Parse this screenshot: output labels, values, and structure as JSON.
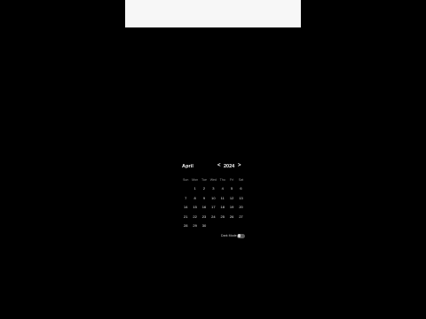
{
  "calendar": {
    "month": "April",
    "year": "2024",
    "prev_label": "<",
    "next_label": ">",
    "weekdays": [
      "Sun",
      "Mon",
      "Tue",
      "Wed",
      "Thu",
      "Fri",
      "Sat"
    ],
    "weeks": [
      [
        "",
        "1",
        "2",
        "3",
        "4",
        "5",
        "6"
      ],
      [
        "7",
        "8",
        "9",
        "10",
        "11",
        "12",
        "13"
      ],
      [
        "14",
        "15",
        "16",
        "17",
        "18",
        "19",
        "20"
      ],
      [
        "21",
        "22",
        "23",
        "24",
        "25",
        "26",
        "27"
      ],
      [
        "28",
        "29",
        "30",
        "",
        "",
        "",
        ""
      ]
    ],
    "toggle_label": "Dark Mode",
    "toggle_on": false
  },
  "colors": {
    "background": "#000000",
    "top_panel": "#f7f7f7",
    "toggle_track": "#5a5a5a"
  }
}
